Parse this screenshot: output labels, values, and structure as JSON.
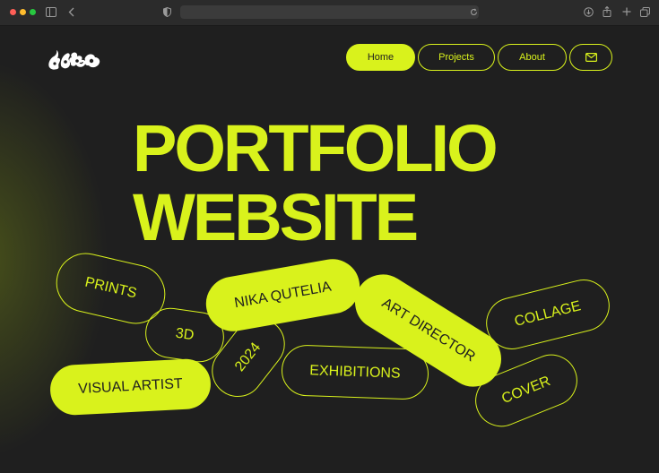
{
  "browser": {
    "icons": [
      "sidebar-icon",
      "back-icon",
      "shield-icon",
      "reload-icon",
      "download-icon",
      "share-icon",
      "new-tab-icon",
      "tabs-icon"
    ]
  },
  "header": {
    "nav": {
      "home": "Home",
      "projects": "Projects",
      "about": "About"
    }
  },
  "hero": {
    "line1": "PORTFOLIO",
    "line2": "WEBSITE"
  },
  "tags": {
    "prints": "PRINTS",
    "name": "NIKA QUTELIA",
    "art_director": "ART DIRECTOR",
    "collage": "COLLAGE",
    "three_d": "3D",
    "year": "2024",
    "exhibitions": "EXHIBITIONS",
    "visual_artist": "VISUAL ARTIST",
    "cover": "COVER"
  },
  "colors": {
    "accent": "#d9f21c",
    "background": "#1f1f1f"
  }
}
